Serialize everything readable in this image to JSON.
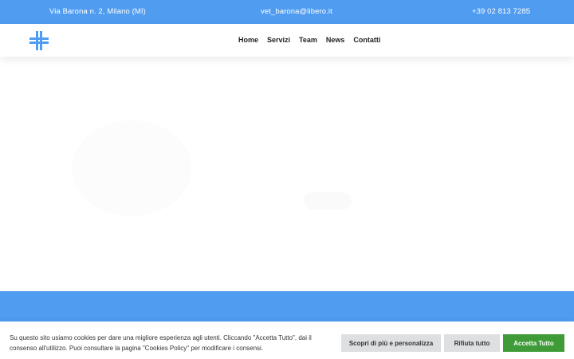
{
  "topbar": {
    "address": "Via Barona n. 2, Milano (MI)",
    "email": "vet_barona@libero.it",
    "phone": "+39 02 813 7285"
  },
  "navbar": {
    "logo_icon": "medical-cross-icon",
    "brand_color": "#4f9cf0",
    "items": [
      {
        "label": "Home"
      },
      {
        "label": "Servizi"
      },
      {
        "label": "Team"
      },
      {
        "label": "News"
      },
      {
        "label": "Contatti"
      }
    ]
  },
  "cookie_banner": {
    "text": "Su questo sito usiamo cookies per dare una migliore esperienza agli utenti. Cliccando \"Accetta Tutto\", dai il consenso all'utilizzo. Puoi consultare la pagina \"Cookies Policy\" per modificare i consensi.",
    "settings_label": "Scopri di più e personalizza",
    "reject_label": "Rifiuta tutto",
    "accept_label": "Accetta Tutto",
    "accept_color": "#3e9b37"
  }
}
